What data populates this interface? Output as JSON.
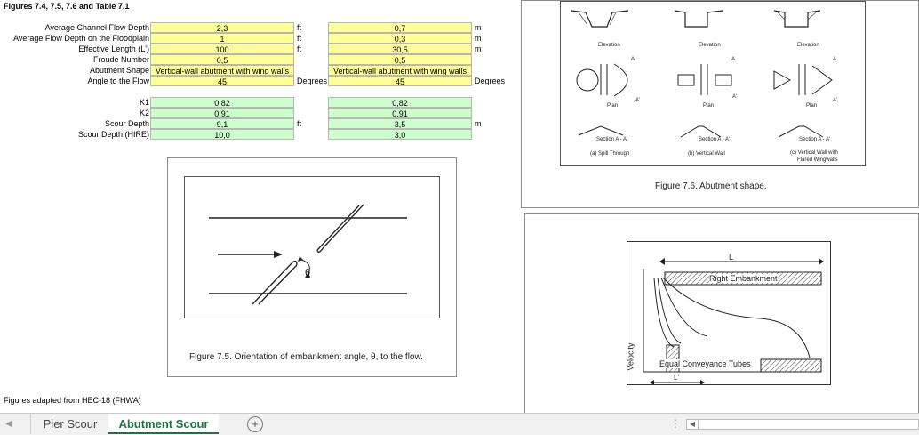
{
  "title": "Figures 7.4, 7.5, 7.6 and Table 7.1",
  "inputs": {
    "labels": [
      "Average Channel Flow Depth",
      "Average Flow Depth on the Floodplain",
      "Effective Length (L')",
      "Froude Number",
      "Abutment Shape",
      "Angle to the Flow"
    ],
    "col1": [
      "2,3",
      "1",
      "100",
      "0,5",
      "Vertical-wall abutment with wing walls",
      "45"
    ],
    "units1": [
      "ft",
      "ft",
      "ft",
      "",
      "",
      "Degrees"
    ],
    "col2": [
      "0,7",
      "0,3",
      "30,5",
      "0,5",
      "Vertical-wall abutment with wing walls",
      "45"
    ],
    "units2": [
      "m",
      "m",
      "m",
      "",
      "",
      "Degrees"
    ]
  },
  "results": {
    "labels": [
      "K1",
      "K2",
      "Scour Depth",
      "Scour Depth (HIRE)"
    ],
    "col1": [
      "0,82",
      "0,91",
      "9,1",
      "10,0"
    ],
    "units1": [
      "",
      "",
      "ft",
      ""
    ],
    "col2": [
      "0,82",
      "0,91",
      "3,5",
      "3,0"
    ],
    "units2": [
      "",
      "",
      "m",
      ""
    ]
  },
  "footer_note": "Figures adapted from HEC-18 (FHWA)",
  "fig75": {
    "caption": "Figure 7.5.  Orientation of embankment angle, θ, to the flow.",
    "theta": "θ"
  },
  "fig76": {
    "caption": "Figure 7.6.  Abutment shape.",
    "elevation": "Elevation",
    "plan": "Plan",
    "section": "Section A - A'",
    "types": [
      "(a) Spill Through",
      "(b) Vertical Wall",
      "(c) Vertical Wall with"
    ],
    "type_c_line2": "Flared Wingwalls",
    "a_label": "A",
    "a_prime": "A'"
  },
  "fig_vel": {
    "L": "L",
    "Lp": "L'",
    "right_emb": "Right Embankment",
    "tubes": "Equal Conveyance Tubes",
    "velocity": "Velocity"
  },
  "tabs": [
    "Pier Scour",
    "Abutment Scour"
  ],
  "add_sheet": "+"
}
